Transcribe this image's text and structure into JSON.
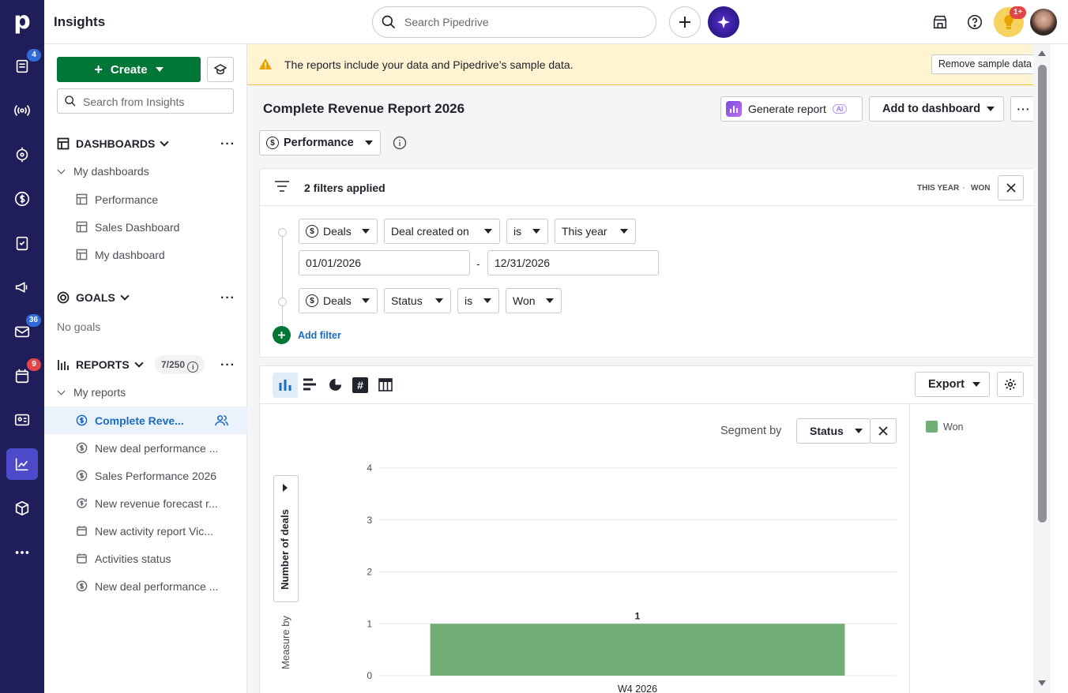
{
  "app": {
    "title": "Insights",
    "search_placeholder": "Search Pipedrive",
    "notif_badge": "1+"
  },
  "rail": {
    "deals_badge": "4",
    "mail_badge": "36",
    "calendar_badge": "9"
  },
  "sidebar": {
    "create_label": "Create",
    "search_placeholder": "Search from Insights",
    "dashboards_label": "DASHBOARDS",
    "my_dashboards_label": "My dashboards",
    "dashboards": [
      "Performance",
      "Sales Dashboard",
      "My dashboard"
    ],
    "goals_label": "GOALS",
    "no_goals": "No goals",
    "reports_label": "REPORTS",
    "reports_count": "7/250",
    "my_reports_label": "My reports",
    "reports": [
      "Complete Reve...",
      "New deal performance ...",
      "Sales Performance 2026",
      "New revenue forecast r...",
      "New activity report Vic...",
      "Activities status",
      "New deal performance ..."
    ]
  },
  "banner": {
    "message": "The reports include your data and Pipedrive’s sample data.",
    "remove_label": "Remove sample data"
  },
  "report": {
    "title": "Complete Revenue Report 2026",
    "generate_label": "Generate report",
    "ai_label": "AI",
    "add_dashboard_label": "Add to dashboard",
    "type_label": "Performance"
  },
  "filters": {
    "summary": "2 filters applied",
    "tag1": "THIS YEAR",
    "sep": "·",
    "tag2": "WON",
    "f1": {
      "entity": "Deals",
      "field": "Deal created on",
      "op": "is",
      "value": "This year",
      "from": "01/01/2026",
      "dash": "-",
      "to": "12/31/2026"
    },
    "f2": {
      "entity": "Deals",
      "field": "Status",
      "op": "is",
      "value": "Won"
    },
    "add_label": "Add filter"
  },
  "chart_panel": {
    "export_label": "Export",
    "segment_label": "Segment by",
    "segment_value": "Status",
    "measure_label": "Measure by",
    "measure_value": "Number of deals"
  },
  "colors": {
    "bar": "#71ae76",
    "legend": "#71ae76",
    "accent": "#017737"
  },
  "chart_data": {
    "type": "bar",
    "categories": [
      "W4 2026"
    ],
    "series": [
      {
        "name": "Won",
        "values": [
          1
        ]
      }
    ],
    "data_labels": [
      "1"
    ],
    "yticks": [
      "0",
      "1",
      "2",
      "3",
      "4"
    ],
    "ylim": [
      0,
      4
    ],
    "legend": [
      "Won"
    ],
    "legend_position": "right",
    "grid": true
  }
}
